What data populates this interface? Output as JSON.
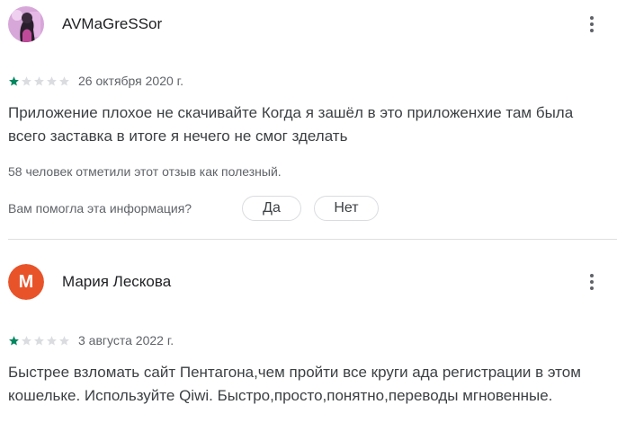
{
  "reviews": [
    {
      "author": "AVMaGreSSor",
      "avatar": {
        "type": "photo"
      },
      "rating": 1,
      "rating_max": 5,
      "date": "26 октября 2020 г.",
      "text": "Приложение плохое не скачивайте Когда я зашёл в это приложенхие там была всего заставка в итоге я нечего не смог зделать",
      "helpful_count_text": "58 человек отметили этот отзыв как полезный.",
      "question": "Вам помогла эта информация?",
      "yes_label": "Да",
      "no_label": "Нет"
    },
    {
      "author": "Мария Лескова",
      "avatar": {
        "type": "letter",
        "letter": "М",
        "color": "#e8532a"
      },
      "rating": 1,
      "rating_max": 5,
      "date": "3 августа 2022 г.",
      "text": "Быстрее взломать сайт Пентагона,чем пройти все круги ада регистрации в этом кошельке. Используйте Qiwi. Быстро,просто,понятно,переводы мгновенные."
    }
  ],
  "colors": {
    "star_filled": "#01875f",
    "star_empty": "#dadce0",
    "letter_avatar": "#e8532a"
  },
  "icons": {
    "menu": "more-vert-icon",
    "star": "star-icon"
  }
}
